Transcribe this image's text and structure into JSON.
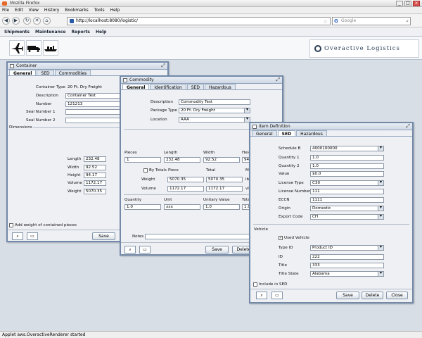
{
  "browser": {
    "title": "Mozilla Firefox",
    "menu": [
      "File",
      "Edit",
      "View",
      "History",
      "Bookmarks",
      "Tools",
      "Help"
    ],
    "url": "http://localhost:8080/logistic/",
    "search_placeholder": "Google",
    "status": "Applet aws.OveractiveRenderer started"
  },
  "app": {
    "menu": [
      "Shipments",
      "Maintenance",
      "Reports",
      "Help"
    ],
    "logo": "Overactive Logistics",
    "tool_icons": [
      "airplane-icon",
      "truck-icon",
      "ship-icon"
    ]
  },
  "container": {
    "title": "Container",
    "tabs": [
      "General",
      "SED",
      "Commodities"
    ],
    "container_type_label": "Container Type",
    "container_type": "20 Ft. Dry Freight",
    "description_label": "Description",
    "description": "Container Test",
    "number_label": "Number",
    "number": "121213",
    "seal1_label": "Seal Number 1",
    "seal2_label": "Seal Number 2",
    "dimensions_label": "Dimensions",
    "length_label": "Length",
    "length": "232.48",
    "width_label": "Width",
    "width": "92.52",
    "height_label": "Height",
    "height": "94.17",
    "volume_label": "Volume",
    "volume": "1172.17",
    "weight_label": "Weight",
    "weight": "5070.35",
    "add_weight_label": "Add weight of contained pieces",
    "save": "Save"
  },
  "commodity": {
    "title": "Commodity",
    "tabs": [
      "General",
      "Identification",
      "SED",
      "Hazardous"
    ],
    "description_label": "Description",
    "description": "Commodity Test",
    "package_type_label": "Package Type",
    "package_type": "20 Ft. Dry Freight",
    "location_label": "Location",
    "location": "AAA",
    "pieces_label": "Pieces",
    "pieces": "1",
    "length_label": "Length",
    "length": "232.48",
    "width_label": "Width",
    "width": "92.52",
    "height_label": "Heig",
    "height": "94.1",
    "by_totals": "By Totals",
    "piece_label": "Piece",
    "total_label": "Total",
    "me_label": "Me",
    "weight_label": "Weight",
    "weight_piece": "5070.35",
    "weight_total": "5070.35",
    "weight_unit": "lb",
    "volume_label": "Volume",
    "volume_piece": "1172.17",
    "volume_total": "1172.17",
    "volume_unit": "vl",
    "quantity_label": "Quantity",
    "quantity": "1.0",
    "unit_label": "Unit",
    "unit": "xxx",
    "unitary_value_label": "Unitary Value",
    "unitary_value": "1.0",
    "tota_label": "Tota",
    "tota": "1.0",
    "notes_label": "Notes",
    "save": "Save",
    "delete": "Delete"
  },
  "item": {
    "title": "Item Definition",
    "tabs": [
      "General",
      "SED",
      "Hazardous"
    ],
    "schedule_b_label": "Schedule B",
    "schedule_b": "4000100000",
    "qty1_label": "Quantity 1",
    "qty1": "1.0",
    "qty2_label": "Quantity 2",
    "qty2": "1.0",
    "value_label": "Value",
    "value": "$0.0",
    "license_type_label": "License Type",
    "license_type": "C30",
    "license_number_label": "License Number",
    "license_number": "111",
    "eccn_label": "ECCN",
    "eccn": "1111",
    "origin_label": "Origin",
    "origin": "Domestic",
    "export_code_label": "Export Code",
    "export_code": "CH",
    "vehicle_label": "Vehicle",
    "used_vehicle": "Used Vehicle",
    "type_id_label": "Type ID",
    "type_id": "Product ID",
    "id_label": "ID",
    "id": "222",
    "title_label": "Title",
    "title_value": "333",
    "title_state_label": "Title State",
    "title_state": "Alabama",
    "include_sed": "Include in SED",
    "save": "Save",
    "delete": "Delete",
    "close": "Close"
  }
}
